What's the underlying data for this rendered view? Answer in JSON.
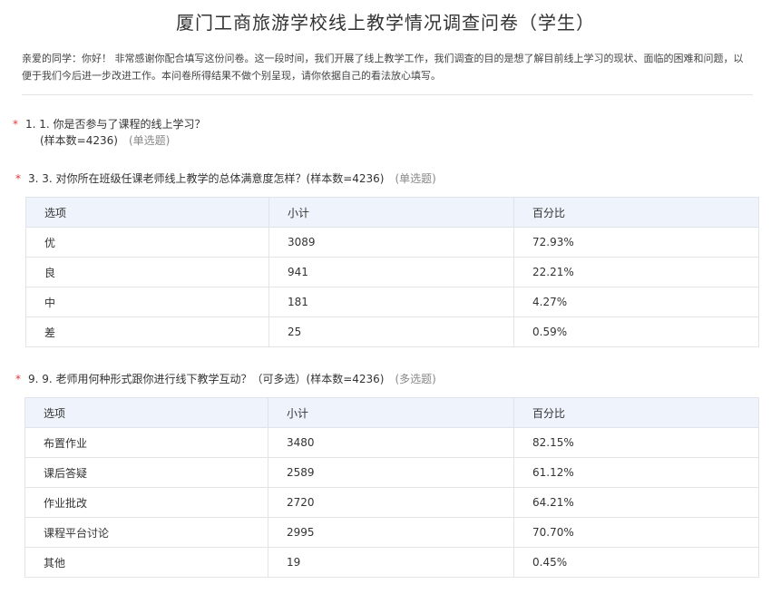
{
  "survey": {
    "title": "厦门工商旅游学校线上教学情况调查问卷（学生）",
    "intro": "亲爱的同学：你好！ 非常感谢你配合填写这份问卷。这一段时间，我们开展了线上教学工作，我们调查的目的是想了解目前线上学习的现状、面临的困难和问题，以便于我们今后进一步改进工作。本问卷所得结果不做个别呈现，请你依据自己的看法放心填写。"
  },
  "required_mark": "*",
  "questions": [
    {
      "text": "1. 1. 你是否参与了课程的线上学习？",
      "sample": "(样本数=4236)",
      "type": "(单选题)"
    },
    {
      "text": "3. 3. 对你所在班级任课老师线上教学的总体满意度怎样？(样本数=4236)",
      "type": "(单选题)",
      "headers": [
        "选项",
        "小计",
        "百分比"
      ],
      "rows": [
        [
          "优",
          "3089",
          "72.93%"
        ],
        [
          "良",
          "941",
          "22.21%"
        ],
        [
          "中",
          "181",
          "4.27%"
        ],
        [
          "差",
          "25",
          "0.59%"
        ]
      ]
    },
    {
      "text": "9. 9. 老师用何种形式跟你进行线下教学互动？（可多选）(样本数=4236)",
      "type": "(多选题)",
      "headers": [
        "选项",
        "小计",
        "百分比"
      ],
      "rows": [
        [
          "布置作业",
          "3480",
          "82.15%"
        ],
        [
          "课后答疑",
          "2589",
          "61.12%"
        ],
        [
          "作业批改",
          "2720",
          "64.21%"
        ],
        [
          "课程平台讨论",
          "2995",
          "70.70%"
        ],
        [
          "其他",
          "19",
          "0.45%"
        ]
      ]
    }
  ]
}
